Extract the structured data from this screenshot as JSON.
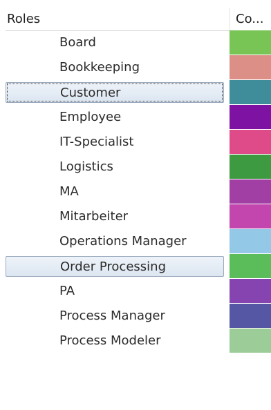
{
  "header": {
    "roles_label": "Roles",
    "color_label": "Co..."
  },
  "rows": [
    {
      "label": "Board",
      "color": "#78c455"
    },
    {
      "label": "Bookkeeping",
      "color": "#dc8f86"
    },
    {
      "label": "Customer",
      "color": "#3f8d9b",
      "selected": true,
      "focused": true
    },
    {
      "label": "Employee",
      "color": "#7d12a3"
    },
    {
      "label": "IT-Specialist",
      "color": "#df4b88"
    },
    {
      "label": "Logistics",
      "color": "#3d9a40"
    },
    {
      "label": "MA",
      "color": "#a23fa4"
    },
    {
      "label": "Mitarbeiter",
      "color": "#c246ad"
    },
    {
      "label": "Operations Manager",
      "color": "#93c8e7"
    },
    {
      "label": "Order Processing",
      "color": "#5bbd5a",
      "selected": true
    },
    {
      "label": "PA",
      "color": "#8644b0"
    },
    {
      "label": "Process Manager",
      "color": "#5556a4"
    },
    {
      "label": "Process Modeler",
      "color": "#9ccc98"
    }
  ]
}
